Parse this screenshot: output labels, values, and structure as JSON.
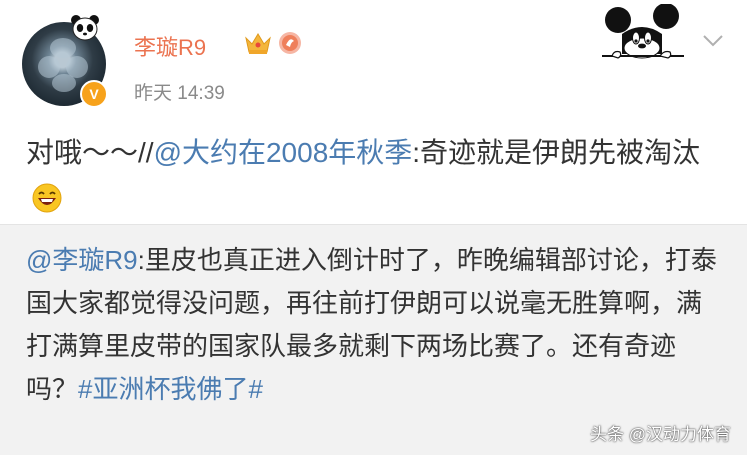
{
  "post": {
    "username": "李璇R9",
    "timestamp": "昨天 14:39",
    "verified_badge": "V",
    "text_prefix": "对哦～～//",
    "mention": "@大约在2008年秋季",
    "text_suffix": ":奇迹就是伊朗先被淘汰",
    "emoji": "laughing-face-icon"
  },
  "repost": {
    "mention": "@李璇R9",
    "text": ":里皮也真正进入倒计时了，昨晚编辑部讨论，打泰国大家都觉得没问题，再往前打伊朗可以说毫无胜算啊，满打满算里皮带的国家队最多就剩下两场比赛了。还有奇迹吗？",
    "hashtag": "#亚洲杯我佛了#"
  },
  "watermark": "头条 @汉动力体育",
  "colors": {
    "username": "#eb7350",
    "link": "#4b7cb1",
    "repost_background": "#f2f2f2",
    "badge": "#f7a21b"
  }
}
